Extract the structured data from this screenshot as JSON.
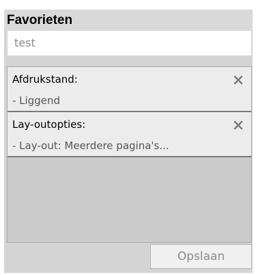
{
  "favorites": {
    "title": "Favorieten",
    "name_value": "test",
    "items": [
      {
        "label": "Afdrukstand:",
        "value": "- Liggend"
      },
      {
        "label": "Lay-outopties:",
        "value": "- Lay-out: Meerdere pagina's..."
      }
    ],
    "close_icon": "x-icon",
    "save_label": "Opslaan"
  },
  "colors": {
    "panel_bg": "#d4d4d4",
    "item_bg": "#ececec",
    "separator": "#7a7a7a",
    "placeholder_text": "#8c8c8c"
  }
}
